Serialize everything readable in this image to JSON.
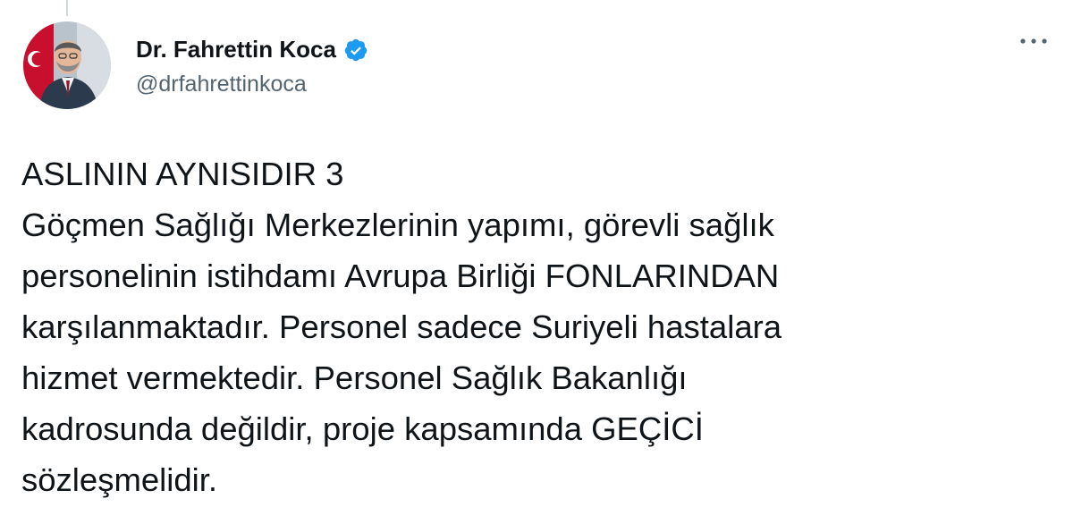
{
  "tweet": {
    "author": {
      "display_name": "Dr. Fahrettin Koca",
      "handle": "@drfahrettinkoca",
      "verified": true,
      "verified_icon": "verified-badge-icon",
      "avatar_icon": "profile-photo"
    },
    "more_icon": "more-options-icon",
    "text": "ASLININ AYNISIDIR 3\nGöçmen Sağlığı Merkezlerinin yapımı, görevli sağlık\npersonelinin istihdamı Avrupa Birliği FONLARINDAN\nkarşılanmaktadır. Personel sadece Suriyeli hastalara\nhizmet vermektedir. Personel Sağlık Bakanlığı\nkadrosunda değildir, proje kapsamında GEÇİCİ\nsözleşmelidir."
  },
  "colors": {
    "text_primary": "#0f1419",
    "text_secondary": "#536471",
    "verified_blue": "#1d9bf0",
    "thread_line": "#cfd9de"
  }
}
